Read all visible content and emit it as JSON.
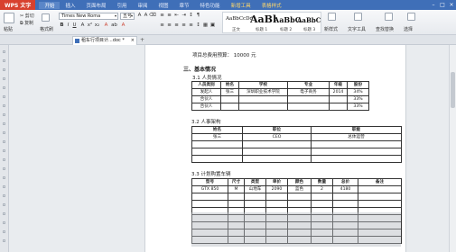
{
  "titlebar": {
    "app": "WPS 文字",
    "menus": [
      "开始",
      "插入",
      "页面布局",
      "引用",
      "审阅",
      "视图",
      "章节",
      "特色功能",
      "新增工具",
      "表格样式"
    ]
  },
  "ribbon": {
    "paste": "粘贴",
    "cut": "剪切",
    "copy": "复制",
    "format_painter": "格式刷",
    "font_name": "Times New Roma",
    "font_size": "五号",
    "styles": [
      {
        "sample": "AaBbCcDd",
        "label": "正文"
      },
      {
        "sample": "AaBl",
        "label": "标题 1"
      },
      {
        "sample": "AaBbC",
        "label": "标题 2"
      },
      {
        "sample": "AaBbC",
        "label": "标题 3"
      }
    ],
    "new_style": "新样式",
    "text_tools": "文字工具",
    "find_replace": "查找替换",
    "select": "选择"
  },
  "tabbar": {
    "doc_tab": "租车行项目计...doc *"
  },
  "document": {
    "budget_line": "项目总费用预算：  10000 元",
    "section_title": "三、基本情况",
    "s31": "3.1 人员情况",
    "t1_headers": [
      "人员类别",
      "姓名",
      "学校",
      "专业",
      "年级",
      "股份"
    ],
    "t1_rows": [
      [
        "发起人",
        "张三",
        "深圳职业技术学院",
        "电子商务",
        "2014",
        "34%"
      ],
      [
        "合伙人",
        "",
        "",
        "",
        "",
        "33%"
      ],
      [
        "合伙人",
        "",
        "",
        "",
        "",
        "33%"
      ]
    ],
    "s32": "3.2 人事架构",
    "t2_headers": [
      "姓名",
      "职位",
      "职能"
    ],
    "t2_rows": [
      [
        "张三",
        "CEO",
        "总体运营"
      ],
      [
        "",
        "",
        ""
      ],
      [
        "",
        "",
        ""
      ],
      [
        "",
        "",
        ""
      ]
    ],
    "s33": "3.3 计划购置车辆",
    "t3_headers": [
      "型号",
      "尺寸",
      "类型",
      "单价",
      "颜色",
      "数量",
      "总价",
      "备注"
    ],
    "t3_rows": [
      [
        "GTX 850",
        "M",
        "山地车",
        "2090",
        "蓝色",
        "2",
        "4180",
        ""
      ],
      [
        "",
        "",
        "",
        "",
        "",
        "",
        "",
        ""
      ],
      [
        "",
        "",
        "",
        "",
        "",
        "",
        "",
        ""
      ],
      [
        "",
        "",
        "",
        "",
        "",
        "",
        "",
        ""
      ],
      [
        "",
        "",
        "",
        "",
        "",
        "",
        "",
        ""
      ],
      [
        "",
        "",
        "",
        "",
        "",
        "",
        "",
        ""
      ],
      [
        "",
        "",
        "",
        "",
        "",
        "",
        "",
        ""
      ],
      [
        "",
        "",
        "",
        "",
        "",
        "",
        "",
        ""
      ]
    ]
  }
}
